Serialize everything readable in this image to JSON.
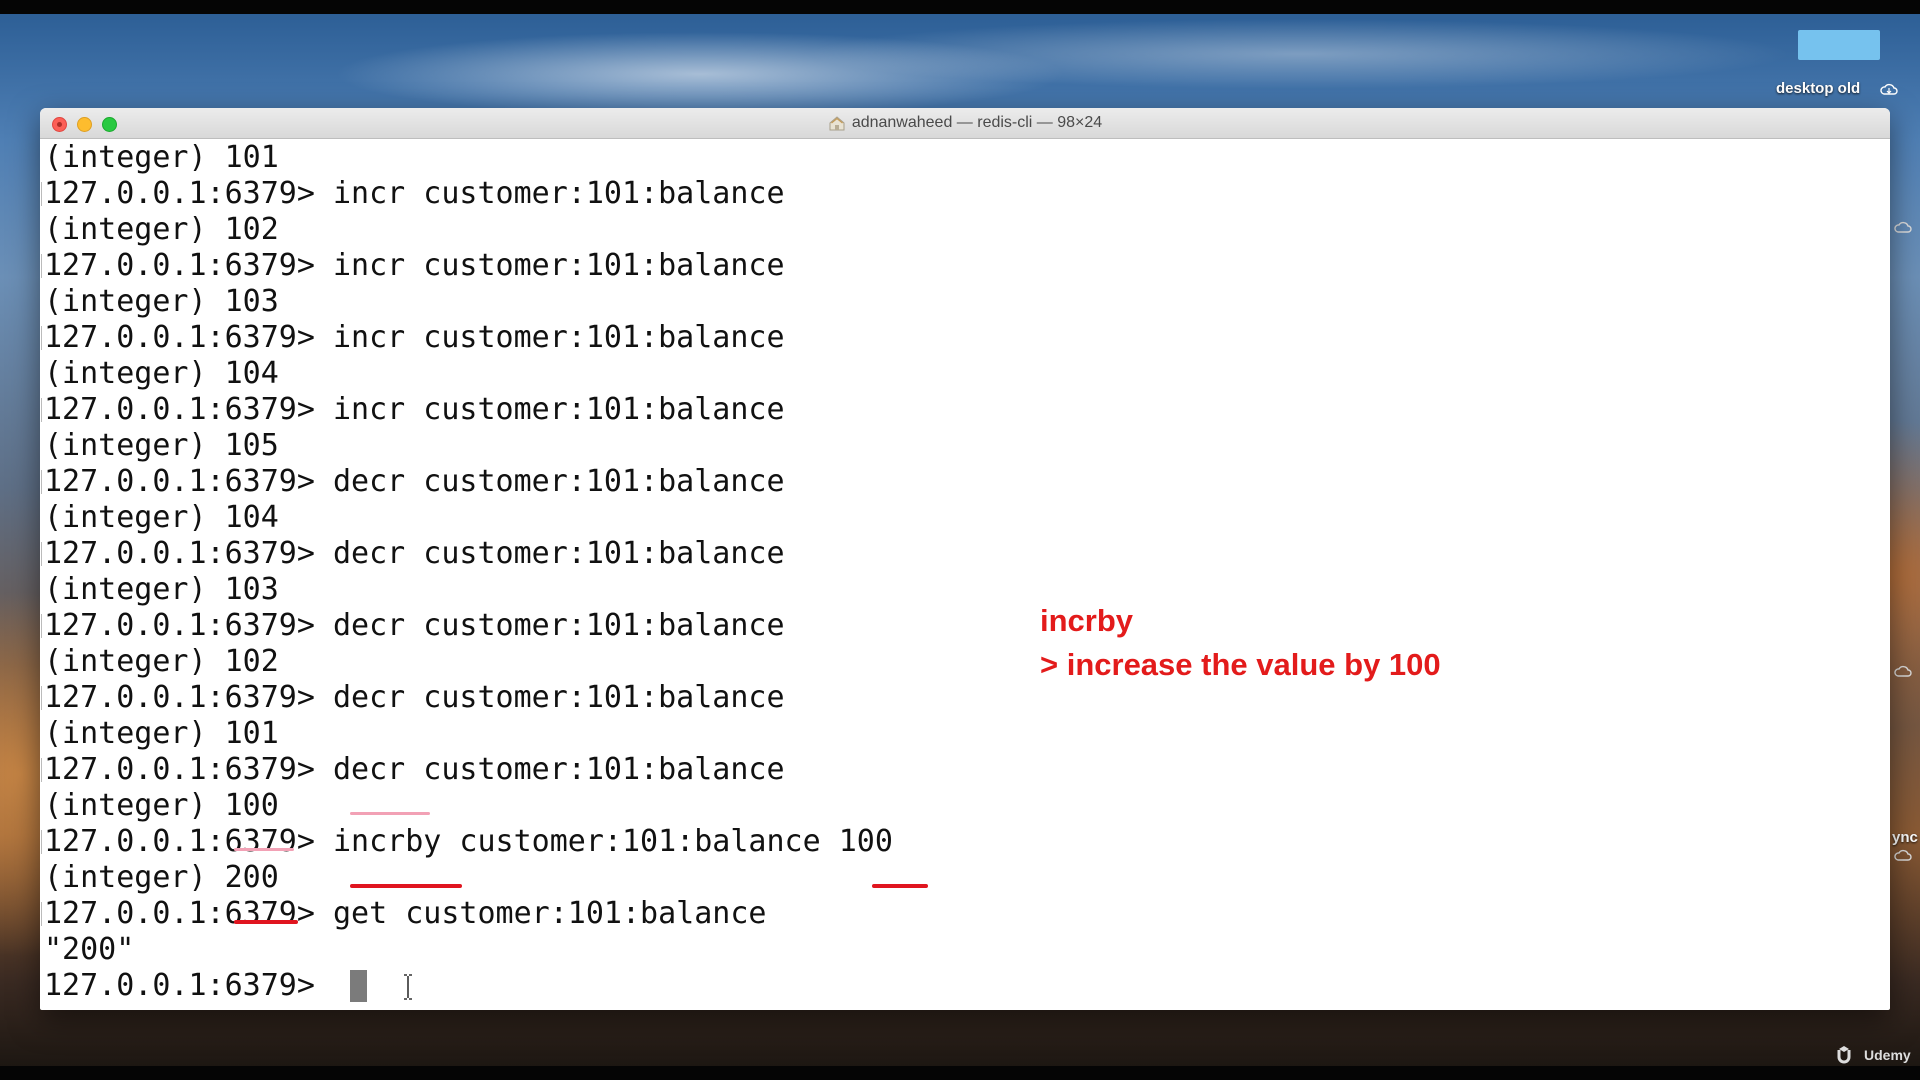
{
  "window": {
    "title": "adnanwaheed — redis-cli — 98×24",
    "buttons": {
      "close": "close",
      "minimize": "minimize",
      "zoom": "zoom"
    }
  },
  "desktop": {
    "folder_label": "desktop old",
    "side_label": "ync"
  },
  "terminal": {
    "lines": [
      "(integer) 101",
      "127.0.0.1:6379> incr customer:101:balance",
      "(integer) 102",
      "127.0.0.1:6379> incr customer:101:balance",
      "(integer) 103",
      "127.0.0.1:6379> incr customer:101:balance",
      "(integer) 104",
      "127.0.0.1:6379> incr customer:101:balance",
      "(integer) 105",
      "127.0.0.1:6379> decr customer:101:balance",
      "(integer) 104",
      "127.0.0.1:6379> decr customer:101:balance",
      "(integer) 103",
      "127.0.0.1:6379> decr customer:101:balance",
      "(integer) 102",
      "127.0.0.1:6379> decr customer:101:balance",
      "(integer) 101",
      "127.0.0.1:6379> decr customer:101:balance",
      "(integer) 100",
      "127.0.0.1:6379> incrby customer:101:balance 100",
      "(integer) 200",
      "127.0.0.1:6379> get customer:101:balance",
      "\"200\"",
      "127.0.0.1:6379> "
    ]
  },
  "annotation": {
    "line1": "incrby",
    "line2": "> increase the value by 100",
    "color": "#e31b1b"
  },
  "branding": {
    "udemy": "Udemy"
  },
  "icons": [
    "home-folder-icon",
    "cloud-icon",
    "i-beam-cursor-icon",
    "udemy-logo-icon"
  ]
}
